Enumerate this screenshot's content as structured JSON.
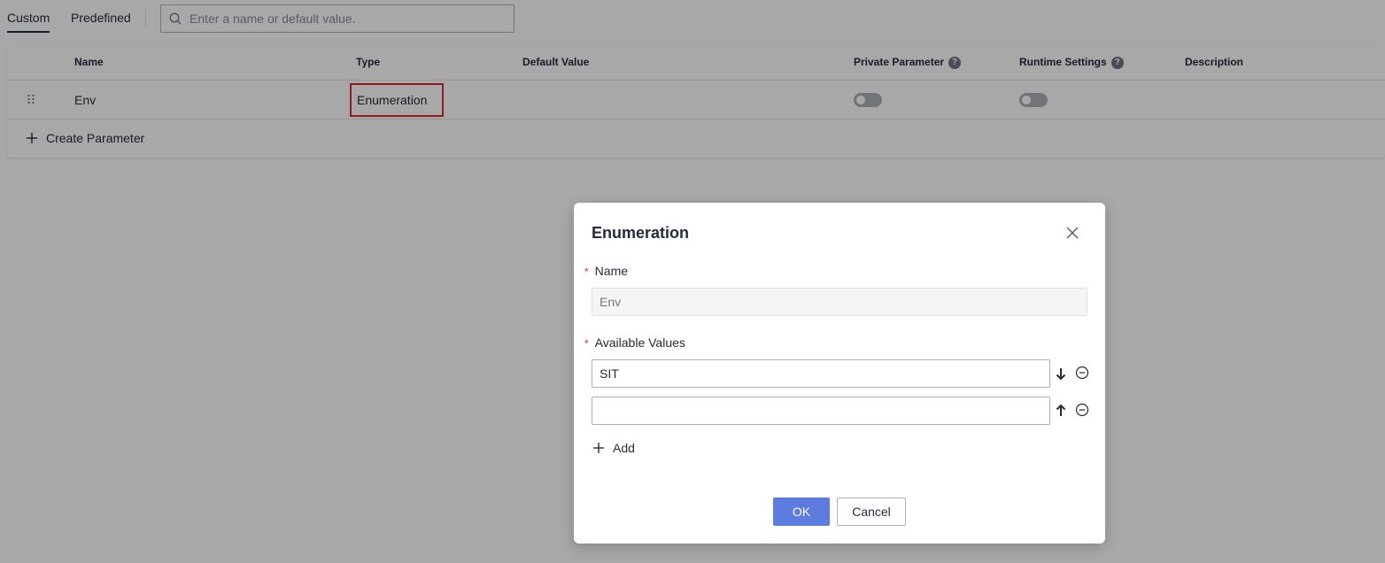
{
  "tabs": {
    "custom": "Custom",
    "predefined": "Predefined"
  },
  "search": {
    "placeholder": "Enter a name or default value."
  },
  "table": {
    "columns": {
      "name": "Name",
      "type": "Type",
      "default_value": "Default Value",
      "private_parameter": "Private Parameter",
      "runtime_settings": "Runtime Settings",
      "description": "Description"
    },
    "rows": [
      {
        "name": "Env",
        "type": "Enumeration",
        "default_value": "",
        "private_parameter": false,
        "runtime_settings": false,
        "description": ""
      }
    ],
    "create_label": "Create Parameter"
  },
  "modal": {
    "title": "Enumeration",
    "name_label": "Name",
    "name_placeholder": "Env",
    "values_label": "Available Values",
    "values": [
      "SIT",
      ""
    ],
    "add_label": "Add",
    "ok_label": "OK",
    "cancel_label": "Cancel"
  },
  "colors": {
    "accent": "#5e7ce0",
    "highlight_border": "#e3262b",
    "required_mark": "#e3262b"
  }
}
